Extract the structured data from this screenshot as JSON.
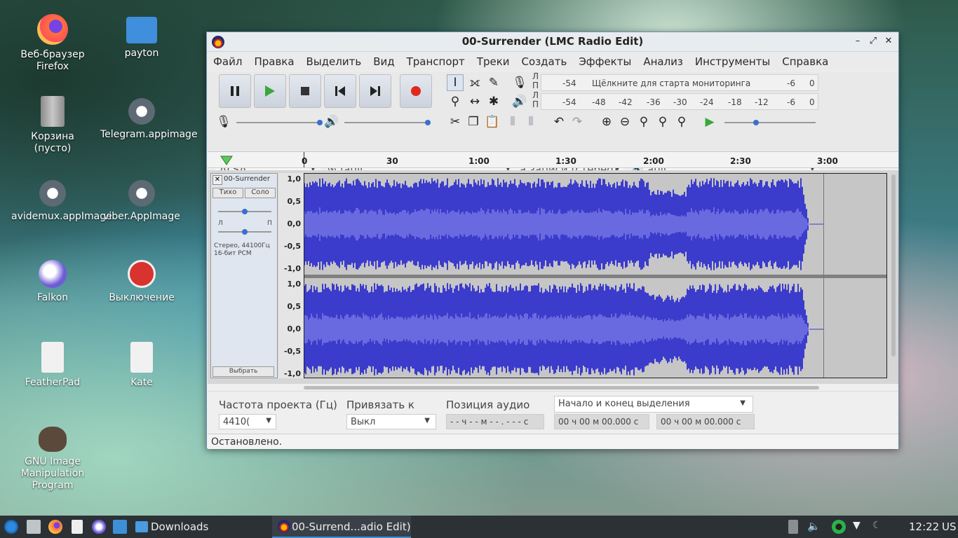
{
  "desktop": {
    "icons": [
      {
        "label": "Веб-браузер Firefox"
      },
      {
        "label": "payton"
      },
      {
        "label": "Корзина (пусто)"
      },
      {
        "label": "Telegram.appimage"
      },
      {
        "label": "avidemux.appImage"
      },
      {
        "label": "viber.AppImage"
      },
      {
        "label": "Falkon"
      },
      {
        "label": "Выключение"
      },
      {
        "label": "FeatherPad"
      },
      {
        "label": "Kate"
      },
      {
        "label": "GNU Image Manipulation Program"
      }
    ]
  },
  "window": {
    "title": "00-Surrender (LMC Radio Edit)",
    "menu": [
      "Файл",
      "Правка",
      "Выделить",
      "Вид",
      "Транспорт",
      "Треки",
      "Создать",
      "Эффекты",
      "Анализ",
      "Инструменты",
      "Справка"
    ],
    "meter_rec_channels": [
      "Л",
      "П"
    ],
    "meter_rec_text": "Щёлкните для старта мониторинга",
    "meter_rec_ticks": [
      "-54",
      "-6",
      "0"
    ],
    "meter_play_ticks": [
      "-54",
      "-48",
      "-42",
      "-36",
      "-30",
      "-24",
      "-18",
      "-12",
      "-6",
      "0"
    ],
    "devices": {
      "host": "ALSA",
      "rec_device": "fault",
      "rec_channels": "а записи (стерео)",
      "play_device": "ault"
    },
    "ruler_ticks": [
      "0",
      "30",
      "1:00",
      "1:30",
      "2:00",
      "2:30",
      "3:00"
    ],
    "track": {
      "name": "00-Surrender",
      "mute": "Тихо",
      "solo": "Соло",
      "pan_left": "Л",
      "pan_right": "П",
      "info": "Стерео, 44100Гц 16-бит PCM",
      "select": "Выбрать",
      "scale": [
        "1,0",
        "0,5",
        "0,0",
        "-0,5",
        "-1,0"
      ]
    },
    "selection": {
      "rate_label": "Частота проекта (Гц)",
      "rate_value": "4410(",
      "snap_label": "Привязать к",
      "snap_value": "Выкл",
      "pos_label": "Позиция аудио",
      "pos_value": "- - ч - - м - - . - - - с",
      "range_label": "Начало и конец выделения",
      "start_value": "00 ч 00 м 00.000 с",
      "end_value": "00 ч 00 м 00.000 с"
    },
    "status": "Остановлено."
  },
  "taskbar": {
    "folder": "Downloads",
    "task": "00-Surrend...adio Edit)",
    "clock": "12:22",
    "layout": "US"
  },
  "colors": {
    "waveform": "#3b3bcc",
    "waveform_rms": "#6a6ae0"
  }
}
